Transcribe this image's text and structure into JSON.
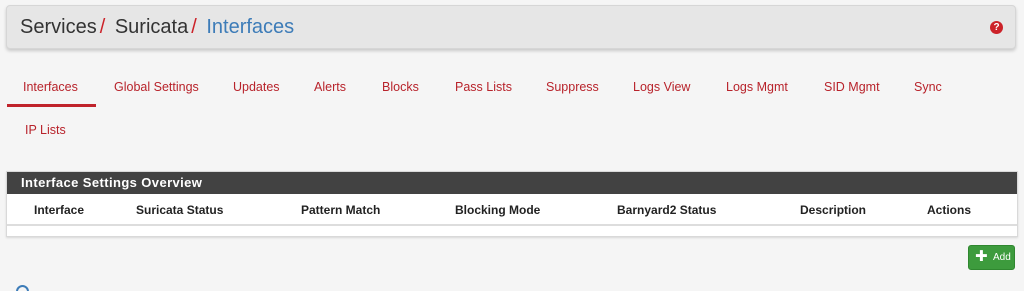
{
  "breadcrumb": {
    "items": [
      "Services",
      "Suricata",
      "Interfaces"
    ],
    "separator": "/"
  },
  "help": {
    "icon": "question-circle-icon",
    "glyph": "?"
  },
  "tabs": [
    {
      "label": "Interfaces",
      "active": true
    },
    {
      "label": "Global Settings",
      "active": false
    },
    {
      "label": "Updates",
      "active": false
    },
    {
      "label": "Alerts",
      "active": false
    },
    {
      "label": "Blocks",
      "active": false
    },
    {
      "label": "Pass Lists",
      "active": false
    },
    {
      "label": "Suppress",
      "active": false
    },
    {
      "label": "Logs View",
      "active": false
    },
    {
      "label": "Logs Mgmt",
      "active": false
    },
    {
      "label": "SID Mgmt",
      "active": false
    },
    {
      "label": "Sync",
      "active": false
    },
    {
      "label": "IP Lists",
      "active": false
    }
  ],
  "panel": {
    "title": "Interface Settings Overview",
    "columns": [
      "Interface",
      "Suricata Status",
      "Pattern Match",
      "Blocking Mode",
      "Barnyard2 Status",
      "Description",
      "Actions"
    ],
    "rows": []
  },
  "add_button": {
    "label": "Add",
    "icon": "plus-icon",
    "glyph": "✚"
  },
  "colors": {
    "accent_red": "#cc2229",
    "link_blue": "#3d7cb8",
    "panel_heading": "#424242",
    "success_green": "#3d9b3d"
  }
}
